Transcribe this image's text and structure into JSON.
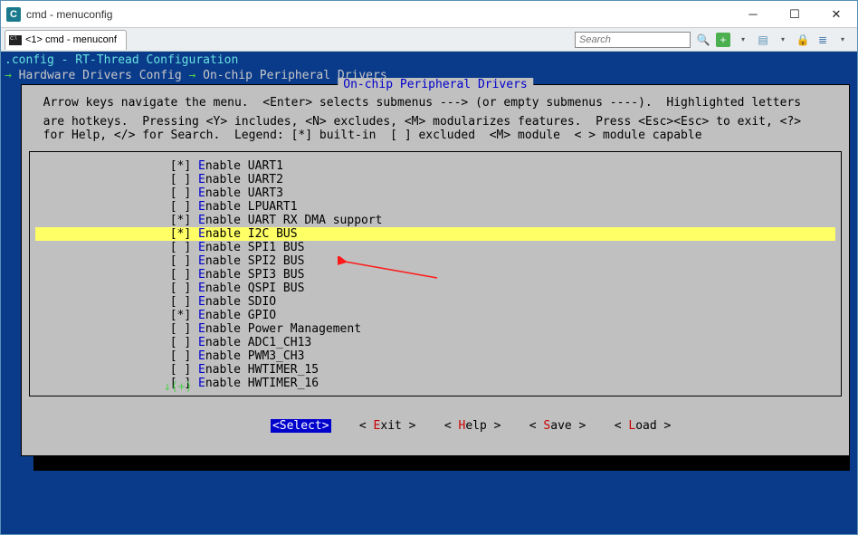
{
  "window": {
    "title": "cmd - menuconfig",
    "tab_label": "<1> cmd - menuconf"
  },
  "search": {
    "placeholder": "Search"
  },
  "config": {
    "title": ".config - RT-Thread Configuration",
    "crumb_arrow": "→",
    "crumb1": "Hardware Drivers Config",
    "crumb2": "On-chip Peripheral Drivers",
    "panel_title": "On-chip Peripheral Drivers",
    "help1": "  Arrow keys navigate the menu.  <Enter> selects submenus ---> (or empty submenus ----).  Highlighted letters",
    "help2": "  are hotkeys.  Pressing <Y> includes, <N> excludes, <M> modularizes features.  Press <Esc><Esc> to exit, <?>",
    "help3": "  for Help, </> for Search.  Legend: [*] built-in  [ ] excluded  <M> module  < > module capable"
  },
  "items": [
    {
      "mark": "*",
      "label": "nable UART1",
      "hl": false
    },
    {
      "mark": " ",
      "label": "nable UART2",
      "hl": false
    },
    {
      "mark": " ",
      "label": "nable UART3",
      "hl": false
    },
    {
      "mark": " ",
      "label": "nable LPUART1",
      "hl": false
    },
    {
      "mark": "*",
      "label": "nable UART RX DMA support",
      "hl": false
    },
    {
      "mark": "*",
      "label": "nable I2C BUS",
      "hl": true
    },
    {
      "mark": " ",
      "label": "nable SPI1 BUS",
      "hl": false
    },
    {
      "mark": " ",
      "label": "nable SPI2 BUS",
      "hl": false
    },
    {
      "mark": " ",
      "label": "nable SPI3 BUS",
      "hl": false
    },
    {
      "mark": " ",
      "label": "nable QSPI BUS",
      "hl": false
    },
    {
      "mark": " ",
      "label": "nable SDIO",
      "hl": false
    },
    {
      "mark": "*",
      "label": "nable GPIO",
      "hl": false
    },
    {
      "mark": " ",
      "label": "nable Power Management",
      "hl": false
    },
    {
      "mark": " ",
      "label": "nable ADC1_CH13",
      "hl": false
    },
    {
      "mark": " ",
      "label": "nable PWM3_CH3",
      "hl": false
    },
    {
      "mark": " ",
      "label": "nable HWTIMER_15",
      "hl": false
    },
    {
      "mark": " ",
      "label": "nable HWTIMER_16",
      "hl": false
    }
  ],
  "scroll_indicator": "↓(+)",
  "buttons": {
    "select": "<Select>",
    "exit_pre": "< ",
    "exit_hk": "E",
    "exit_post": "xit >",
    "help_pre": "< ",
    "help_hk": "H",
    "help_post": "elp >",
    "save_pre": "< ",
    "save_hk": "S",
    "save_post": "ave >",
    "load_pre": "< ",
    "load_hk": "L",
    "load_post": "oad >"
  }
}
